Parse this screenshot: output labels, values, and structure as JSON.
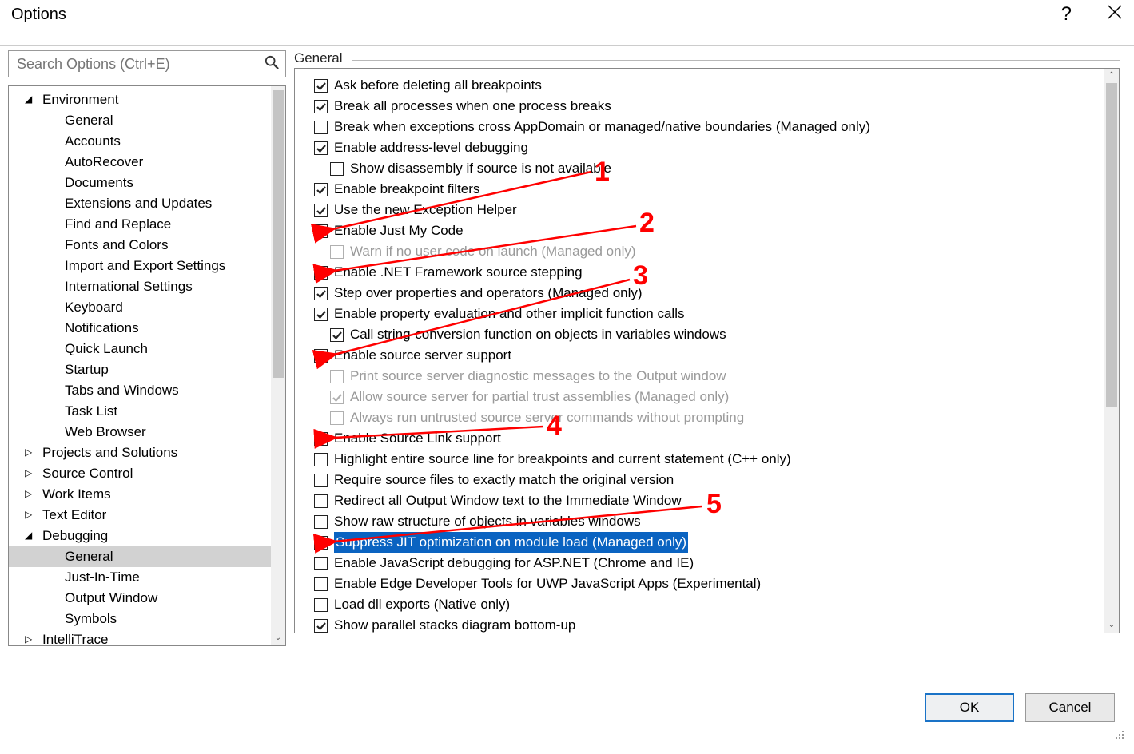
{
  "window": {
    "title": "Options"
  },
  "search": {
    "placeholder": "Search Options (Ctrl+E)"
  },
  "section": {
    "label": "General"
  },
  "tree": {
    "items": [
      {
        "label": "Environment",
        "level": 1,
        "expanded": true
      },
      {
        "label": "General",
        "level": 2
      },
      {
        "label": "Accounts",
        "level": 2
      },
      {
        "label": "AutoRecover",
        "level": 2
      },
      {
        "label": "Documents",
        "level": 2
      },
      {
        "label": "Extensions and Updates",
        "level": 2
      },
      {
        "label": "Find and Replace",
        "level": 2
      },
      {
        "label": "Fonts and Colors",
        "level": 2
      },
      {
        "label": "Import and Export Settings",
        "level": 2
      },
      {
        "label": "International Settings",
        "level": 2
      },
      {
        "label": "Keyboard",
        "level": 2
      },
      {
        "label": "Notifications",
        "level": 2
      },
      {
        "label": "Quick Launch",
        "level": 2
      },
      {
        "label": "Startup",
        "level": 2
      },
      {
        "label": "Tabs and Windows",
        "level": 2
      },
      {
        "label": "Task List",
        "level": 2
      },
      {
        "label": "Web Browser",
        "level": 2
      },
      {
        "label": "Projects and Solutions",
        "level": 1,
        "collapsed": true
      },
      {
        "label": "Source Control",
        "level": 1,
        "collapsed": true
      },
      {
        "label": "Work Items",
        "level": 1,
        "collapsed": true
      },
      {
        "label": "Text Editor",
        "level": 1,
        "collapsed": true
      },
      {
        "label": "Debugging",
        "level": 1,
        "expanded": true
      },
      {
        "label": "General",
        "level": 2,
        "selected": true
      },
      {
        "label": "Just-In-Time",
        "level": 2
      },
      {
        "label": "Output Window",
        "level": 2
      },
      {
        "label": "Symbols",
        "level": 2
      },
      {
        "label": "IntelliTrace",
        "level": 1,
        "collapsed": true
      }
    ]
  },
  "options": [
    {
      "indent": 1,
      "checked": true,
      "label": "Ask before deleting all breakpoints"
    },
    {
      "indent": 1,
      "checked": true,
      "label": "Break all processes when one process breaks"
    },
    {
      "indent": 1,
      "checked": false,
      "label": "Break when exceptions cross AppDomain or managed/native boundaries (Managed only)"
    },
    {
      "indent": 1,
      "checked": true,
      "label": "Enable address-level debugging"
    },
    {
      "indent": 2,
      "checked": false,
      "label": "Show disassembly if source is not available"
    },
    {
      "indent": 1,
      "checked": true,
      "label": "Enable breakpoint filters"
    },
    {
      "indent": 1,
      "checked": true,
      "label": "Use the new Exception Helper"
    },
    {
      "indent": 1,
      "checked": false,
      "label": "Enable Just My Code"
    },
    {
      "indent": 2,
      "checked": false,
      "disabled": true,
      "label": "Warn if no user code on launch (Managed only)"
    },
    {
      "indent": 1,
      "checked": true,
      "label": "Enable .NET Framework source stepping"
    },
    {
      "indent": 1,
      "checked": true,
      "label": "Step over properties and operators (Managed only)"
    },
    {
      "indent": 1,
      "checked": true,
      "label": "Enable property evaluation and other implicit function calls"
    },
    {
      "indent": 2,
      "checked": true,
      "label": "Call string-conversion function on objects in variables windows"
    },
    {
      "indent": 1,
      "checked": false,
      "label": "Enable source server support"
    },
    {
      "indent": 2,
      "checked": false,
      "disabled": true,
      "label": "Print source server diagnostic messages to the Output window"
    },
    {
      "indent": 2,
      "checked": true,
      "disabled": true,
      "label": "Allow source server for partial trust assemblies (Managed only)"
    },
    {
      "indent": 2,
      "checked": false,
      "disabled": true,
      "label": "Always run untrusted source server commands without prompting"
    },
    {
      "indent": 1,
      "checked": true,
      "label": "Enable Source Link support"
    },
    {
      "indent": 1,
      "checked": false,
      "label": "Highlight entire source line for breakpoints and current statement (C++ only)"
    },
    {
      "indent": 1,
      "checked": false,
      "label": "Require source files to exactly match the original version"
    },
    {
      "indent": 1,
      "checked": false,
      "label": "Redirect all Output Window text to the Immediate Window"
    },
    {
      "indent": 1,
      "checked": false,
      "label": "Show raw structure of objects in variables windows"
    },
    {
      "indent": 1,
      "checked": true,
      "highlight": true,
      "label": "Suppress JIT optimization on module load (Managed only)"
    },
    {
      "indent": 1,
      "checked": false,
      "label": "Enable JavaScript debugging for ASP.NET (Chrome and IE)"
    },
    {
      "indent": 1,
      "checked": false,
      "label": "Enable Edge Developer Tools for UWP JavaScript Apps (Experimental)"
    },
    {
      "indent": 1,
      "checked": false,
      "label": "Load dll exports (Native only)"
    },
    {
      "indent": 1,
      "checked": true,
      "label": "Show parallel stacks diagram bottom-up"
    }
  ],
  "buttons": {
    "ok": "OK",
    "cancel": "Cancel"
  },
  "annotations": {
    "n1": "1",
    "n2": "2",
    "n3": "3",
    "n4": "4",
    "n5": "5"
  }
}
